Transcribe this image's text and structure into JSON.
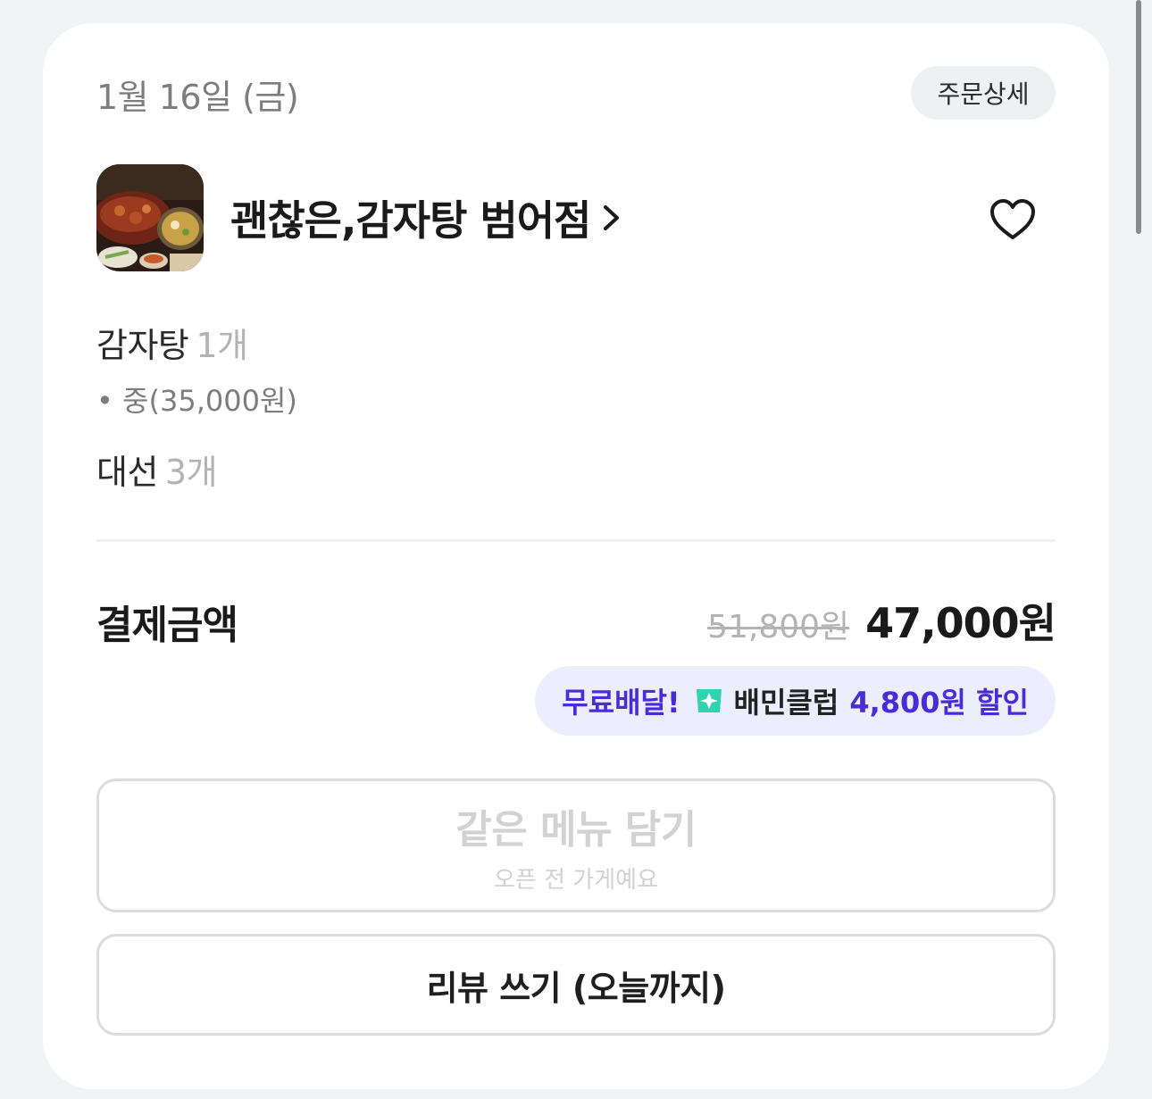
{
  "order": {
    "date": "1월 16일 (금)",
    "detail_button": "주문상세"
  },
  "store": {
    "name": "괜찮은,감자탕 범어점",
    "thumbnail_icon": "store-photo",
    "favorite_icon": "heart-outline-icon"
  },
  "items": [
    {
      "name": "감자탕",
      "qty": "1개",
      "option": "• 중(35,000원)"
    },
    {
      "name": "대선",
      "qty": "3개"
    }
  ],
  "payment": {
    "label": "결제금액",
    "original_price": "51,800원",
    "final_price": "47,000원"
  },
  "promo": {
    "free_delivery": "무료배달!",
    "club_icon": "baemin-club-star-icon",
    "club_name": "배민클럽",
    "discount": "4,800원 할인"
  },
  "buttons": {
    "reorder_label": "같은 메뉴 담기",
    "reorder_sub": "오픈 전 가게예요",
    "review_label": "리뷰 쓰기 (오늘까지)"
  },
  "colors": {
    "accent": "#4a2bd8",
    "promo_bg": "#eceefe",
    "club_icon": "#2fd3b0"
  }
}
